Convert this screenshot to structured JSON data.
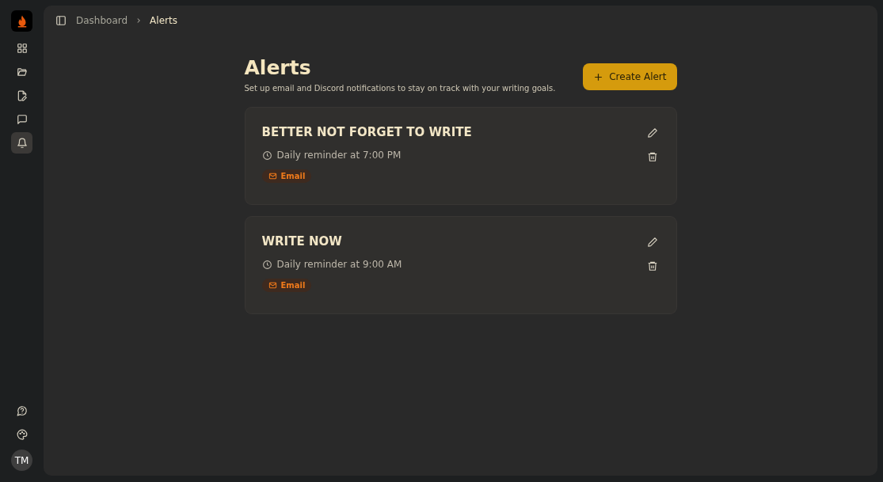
{
  "sidebar": {
    "nav": [
      {
        "kind": "grid",
        "selected": false
      },
      {
        "kind": "folder",
        "selected": false
      },
      {
        "kind": "file-edit",
        "selected": false
      },
      {
        "kind": "message",
        "selected": false
      },
      {
        "kind": "bell",
        "selected": true
      }
    ],
    "bottom": [
      {
        "kind": "help"
      },
      {
        "kind": "palette"
      }
    ],
    "avatar": "TM"
  },
  "breadcrumb": [
    "Dashboard",
    "Alerts"
  ],
  "page": {
    "title": "Alerts",
    "subtitle": "Set up email and Discord notifications to stay on track with your writing goals.",
    "create_button": "Create Alert"
  },
  "alerts": [
    {
      "title": "BETTER NOT FORGET TO WRITE",
      "schedule": "Daily reminder at 7:00 PM",
      "channel": "Email"
    },
    {
      "title": "WRITE NOW",
      "schedule": "Daily reminder at 9:00 AM",
      "channel": "Email"
    }
  ]
}
